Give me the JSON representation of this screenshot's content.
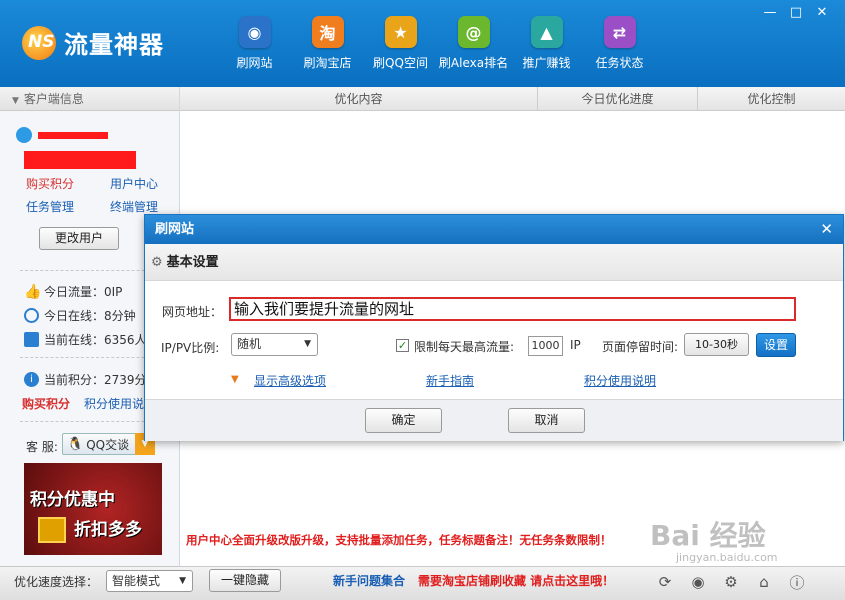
{
  "app": {
    "name": "流量神器",
    "logo_mark": "NS"
  },
  "nav": [
    {
      "label": "刷网站",
      "icon": "globe-icon",
      "color": "#2a73c9",
      "glyph": "◉"
    },
    {
      "label": "刷淘宝店",
      "icon": "taobao-icon",
      "color": "#f07d1e",
      "glyph": "淘"
    },
    {
      "label": "刷QQ空间",
      "icon": "star-icon",
      "color": "#e9a41a",
      "glyph": "★"
    },
    {
      "label": "刷Alexa排名",
      "icon": "alexa-icon",
      "color": "#6bb82e",
      "glyph": "@"
    },
    {
      "label": "推广赚钱",
      "icon": "rocket-icon",
      "color": "#2aa8a0",
      "glyph": "▲"
    },
    {
      "label": "任务状态",
      "icon": "exchange-icon",
      "color": "#9b4fc7",
      "glyph": "⇄"
    }
  ],
  "window_controls": {
    "minimize": "—",
    "maximize": "□",
    "close": "✕"
  },
  "sidebar": {
    "header": "客户端信息",
    "links": {
      "buy_points": "购买积分",
      "user_center": "用户中心",
      "task_manage": "任务管理",
      "terminal_manage": "终端管理"
    },
    "change_user": "更改用户",
    "stats": {
      "today_traffic": "今日流量：0IP",
      "today_online": "今日在线：8分钟",
      "current_online": "当前在线：6356人",
      "current_points": "当前积分：2739分"
    },
    "buy_points_2": "购买积分",
    "points_usage": "积分使用说明",
    "service_label": "客 服:",
    "qq_chat": "QQ交谈",
    "promo": {
      "line1": "积分优惠中",
      "line2": "折扣多多"
    }
  },
  "table": {
    "columns": [
      "优化内容",
      "今日优化进度",
      "优化控制"
    ]
  },
  "notice": "用户中心全面升级改版升级，支持批量添加任务，任务标题备注！无任务条数限制！",
  "bottom": {
    "speed_label": "优化速度选择：",
    "speed_value": "智能模式",
    "hide_button": "一键隐藏",
    "help_link": "新手问题集合",
    "taobao_link": "需要淘宝店铺刷收藏 请点击这里哦！"
  },
  "watermark": {
    "text": "Bai 经验",
    "sub": "jingyan.baidu.com"
  },
  "dialog": {
    "title": "刷网站",
    "section": "基本设置",
    "url_label": "网页地址：",
    "url_value": "输入我们要提升流量的网址",
    "ratio_label": "IP/PV比例:",
    "ratio_value": "随机",
    "limit_label": "限制每天最高流量:",
    "limit_checked": true,
    "limit_value": "1000",
    "limit_unit": "IP",
    "stay_label": "页面停留时间:",
    "stay_value": "10-30秒",
    "settings_button": "设置",
    "advanced_link": "显示高级选项",
    "guide_link": "新手指南",
    "points_link": "积分使用说明",
    "ok": "确定",
    "cancel": "取消"
  }
}
